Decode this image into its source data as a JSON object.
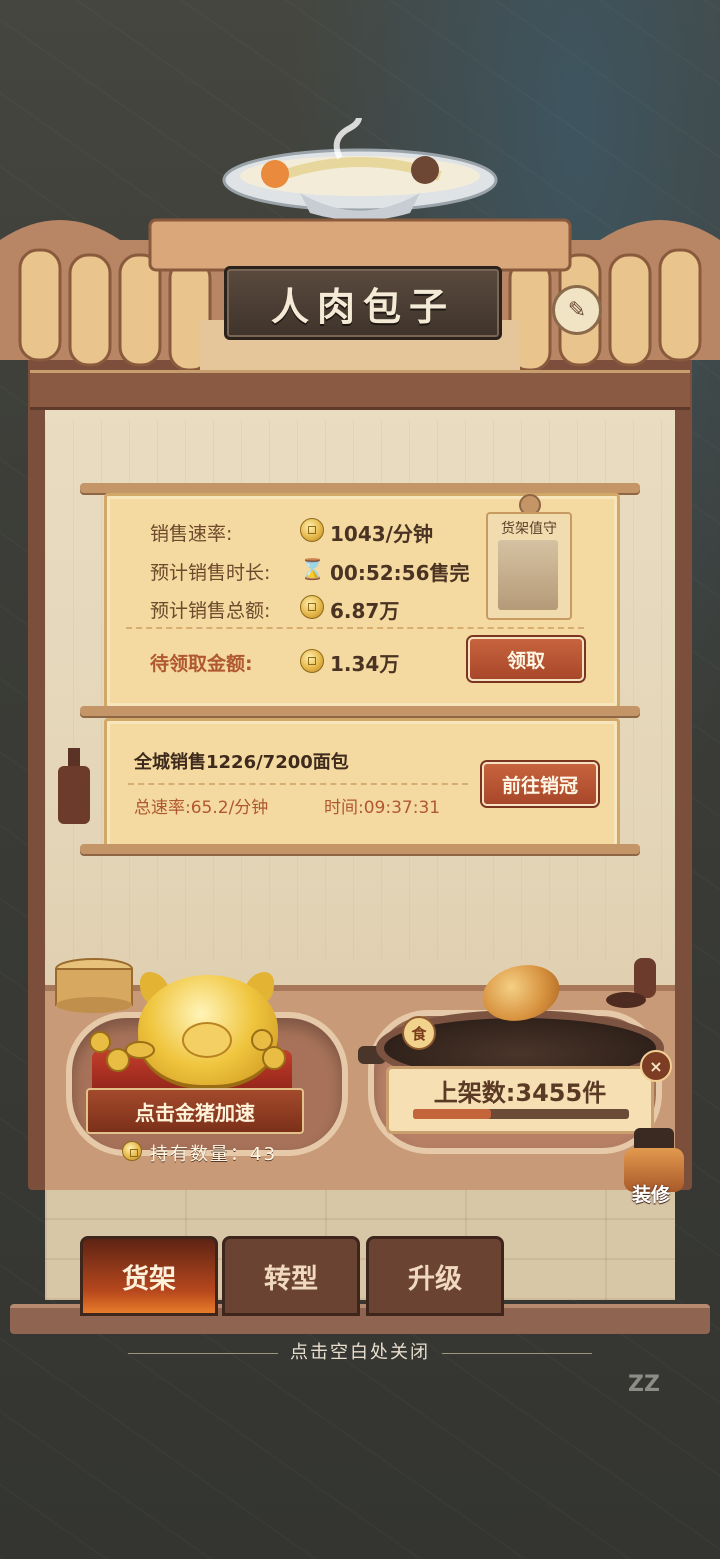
{
  "shop": {
    "title": "人肉包子"
  },
  "stats": {
    "sales_rate_label": "销售速率:",
    "sales_rate_value": "1043/分钟",
    "est_duration_label": "预计销售时长:",
    "est_duration_value": "00:52:56售完",
    "est_total_label": "预计销售总额:",
    "est_total_value": "6.87万",
    "pending_label": "待领取金额:",
    "pending_value": "1.34万",
    "collect_button": "领取",
    "guard_title": "货架值守"
  },
  "citywide": {
    "sales_text": "全城销售1226/7200面包",
    "rate_text": "总速率:65.2/分钟",
    "time_text": "时间:09:37:31",
    "go_button": "前往销冠"
  },
  "counter": {
    "pig_button": "点击金猪加速",
    "hold_label": "持有数量：43",
    "food_badge": "食",
    "shelf_label": "上架数:3455件",
    "shelf_progress": 0.36,
    "close_glyph": "×",
    "decorate_label": "装修"
  },
  "tabs": [
    {
      "label": "货架",
      "active": true
    },
    {
      "label": "转型",
      "active": false
    },
    {
      "label": "升级",
      "active": false
    }
  ],
  "footer": {
    "close_hint": "点击空白处关闭",
    "sleep_icon": "ZZ"
  },
  "colors": {
    "accent": "#b0582f",
    "button_red": "#a8472a",
    "board": "#f4d9a0"
  }
}
